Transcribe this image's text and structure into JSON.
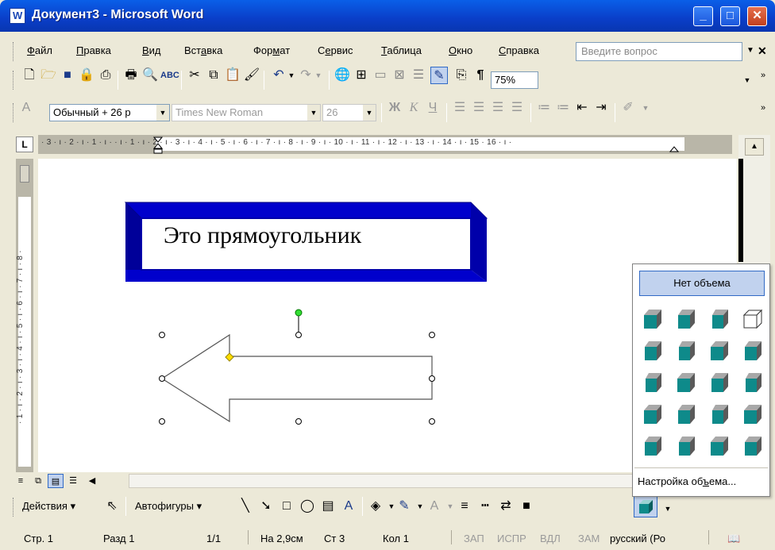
{
  "window": {
    "title": "Документ3 - Microsoft Word"
  },
  "menu": {
    "items": [
      {
        "pre": "",
        "u": "Ф",
        "post": "айл"
      },
      {
        "pre": "",
        "u": "П",
        "post": "равка"
      },
      {
        "pre": "",
        "u": "В",
        "post": "ид"
      },
      {
        "pre": "Вст",
        "u": "а",
        "post": "вка"
      },
      {
        "pre": "Фор",
        "u": "м",
        "post": "ат"
      },
      {
        "pre": "С",
        "u": "е",
        "post": "рвис"
      },
      {
        "pre": "",
        "u": "Т",
        "post": "аблица"
      },
      {
        "pre": "",
        "u": "О",
        "post": "кно"
      },
      {
        "pre": "",
        "u": "С",
        "post": "правка"
      }
    ],
    "ask_placeholder": "Введите вопрос"
  },
  "standard_toolbar": {
    "zoom": "75%"
  },
  "formatting_toolbar": {
    "style": "Обычный + 26 р",
    "font": "Times New Roman",
    "size": "26"
  },
  "ruler": {
    "horizontal": "· 3 · ı · 2 · ı · 1 · ı ·   · ı · 1 · ı · 2 · ı · 3 · ı · 4 · ı · 5 · ı · 6 · ı · 7 · ı · 8 · ı · 9 · ı · 10 · ı · 11 · ı · 12 · ı · 13 · ı · 14 · ı · 15   · 16 · ı ·",
    "vertical": "· 1 · ı · 2 · ı · 3 · ı · 4 · ı · 5 · ı · 6 · ı · 7 · ı · 8 ·",
    "corner": "L"
  },
  "document": {
    "rectangle_text": "Это прямоугольник"
  },
  "drawing_toolbar": {
    "actions": "Действия",
    "autoshapes": "Автофигуры"
  },
  "popup_3d": {
    "none_label": "Нет объема",
    "settings_pre": "Настройка об",
    "settings_u": "ъ",
    "settings_post": "ема..."
  },
  "status": {
    "page": "Стр. 1",
    "section": "Разд 1",
    "pages": "1/1",
    "at": "На 2,9см",
    "line": "Ст 3",
    "col": "Кол 1",
    "rec": "ЗАП",
    "trk": "ИСПР",
    "ext": "ВДЛ",
    "ovr": "ЗАМ",
    "lang": "русский (Ро"
  },
  "colors": {
    "rect_face": "#0000cc",
    "rect_side": "#000080",
    "cube_face": "#0e8a8a",
    "title_blue": "#0a3ec8"
  }
}
